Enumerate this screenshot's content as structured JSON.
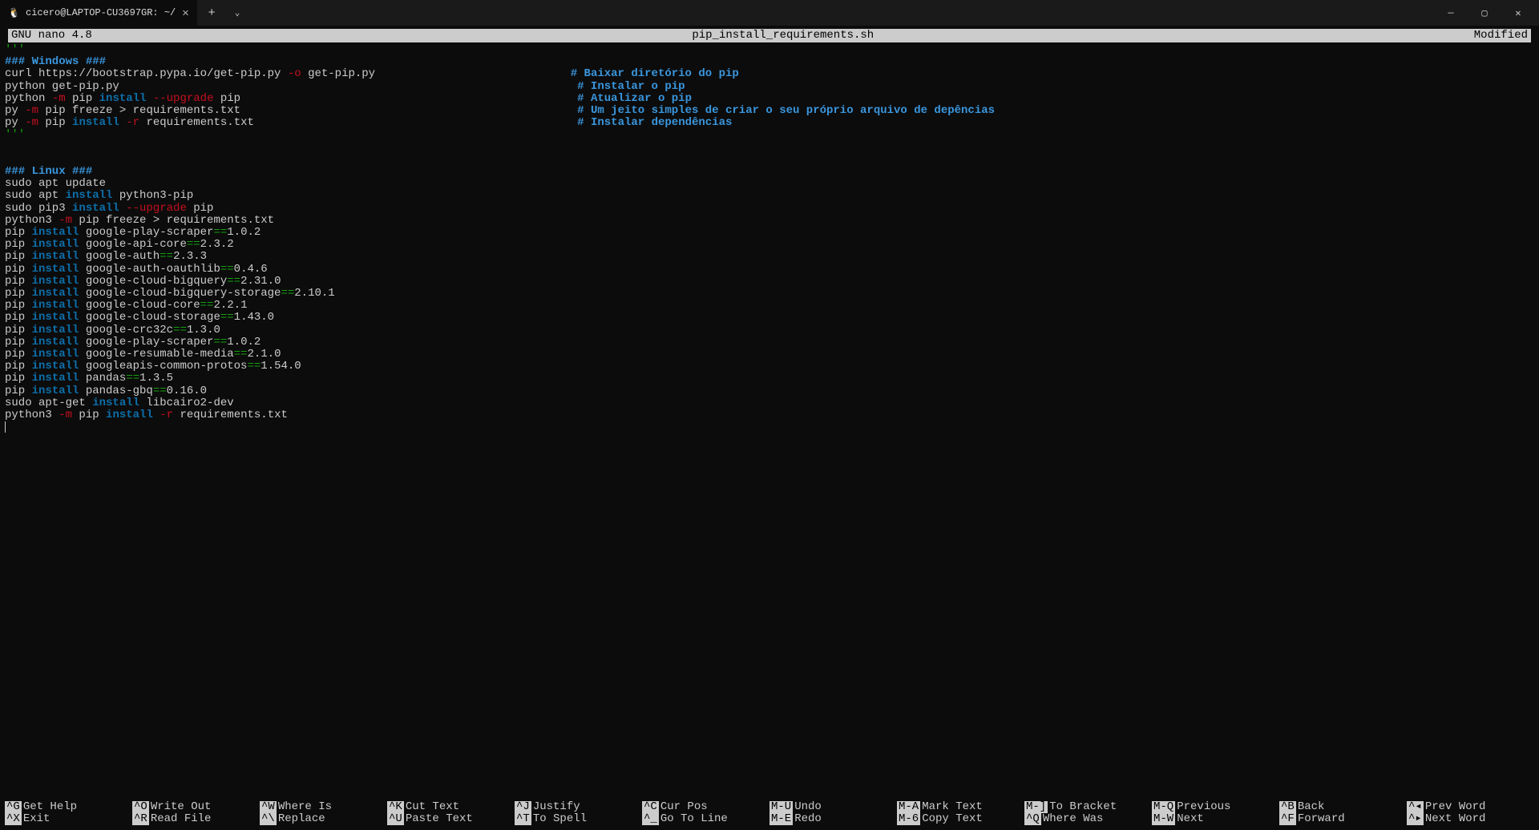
{
  "titlebar": {
    "tab_title": "cicero@LAPTOP-CU3697GR: ~/"
  },
  "nano": {
    "app": "GNU nano 4.8",
    "filename": "pip_install_requirements.sh",
    "status": "Modified"
  },
  "content": {
    "tq1": "'''",
    "win_header": "### Windows ###",
    "l_curl_a": "curl https://bootstrap.pypa.io/get-pip.py ",
    "l_curl_flag": "-o",
    "l_curl_b": " get-pip.py",
    "c1": "# Baixar diretório do pip",
    "l_getpip": "python get-pip.py",
    "c2": "# Instalar o pip",
    "l_upg_a": "python ",
    "l_upg_flag1": "-m",
    "l_upg_b": " pip ",
    "l_upg_install": "install",
    "l_upg_flag2": " --upgrade",
    "l_upg_c": " pip",
    "c3": "# Atualizar o pip",
    "l_freeze_a": "py ",
    "l_freeze_flag": "-m",
    "l_freeze_b": " pip freeze > requirements.txt",
    "c4": "# Um jeito simples de criar o seu próprio arquivo de depências",
    "l_req_a": "py ",
    "l_req_flag1": "-m",
    "l_req_b": " pip ",
    "l_req_install": "install",
    "l_req_flag2": " -r",
    "l_req_c": " requirements.txt",
    "c5": "# Instalar dependências",
    "tq2": "'''",
    "lin_header": "### Linux ###",
    "l_update": "sudo apt update",
    "l_aptinst_a": "sudo apt ",
    "l_aptinst_install": "install",
    "l_aptinst_b": " python3-pip",
    "l_pip3_a": "sudo pip3 ",
    "l_pip3_install": "install",
    "l_pip3_flag": " --upgrade",
    "l_pip3_b": " pip",
    "l_freeze3_a": "python3 ",
    "l_freeze3_f": "-m",
    "l_freeze3_b": " pip freeze > requirements.txt",
    "pkg": [
      {
        "pre": "pip ",
        "inst": "install",
        "mid": " google-play-scraper",
        "eq": "==",
        "ver": "1.0.2"
      },
      {
        "pre": "pip ",
        "inst": "install",
        "mid": " google-api-core",
        "eq": "==",
        "ver": "2.3.2"
      },
      {
        "pre": "pip ",
        "inst": "install",
        "mid": " google-auth",
        "eq": "==",
        "ver": "2.3.3"
      },
      {
        "pre": "pip ",
        "inst": "install",
        "mid": " google-auth-oauthlib",
        "eq": "==",
        "ver": "0.4.6"
      },
      {
        "pre": "pip ",
        "inst": "install",
        "mid": " google-cloud-bigquery",
        "eq": "==",
        "ver": "2.31.0"
      },
      {
        "pre": "pip ",
        "inst": "install",
        "mid": " google-cloud-bigquery-storage",
        "eq": "==",
        "ver": "2.10.1"
      },
      {
        "pre": "pip ",
        "inst": "install",
        "mid": " google-cloud-core",
        "eq": "==",
        "ver": "2.2.1"
      },
      {
        "pre": "pip ",
        "inst": "install",
        "mid": " google-cloud-storage",
        "eq": "==",
        "ver": "1.43.0"
      },
      {
        "pre": "pip ",
        "inst": "install",
        "mid": " google-crc32c",
        "eq": "==",
        "ver": "1.3.0"
      },
      {
        "pre": "pip ",
        "inst": "install",
        "mid": " google-play-scraper",
        "eq": "==",
        "ver": "1.0.2"
      },
      {
        "pre": "pip ",
        "inst": "install",
        "mid": " google-resumable-media",
        "eq": "==",
        "ver": "2.1.0"
      },
      {
        "pre": "pip ",
        "inst": "install",
        "mid": " googleapis-common-protos",
        "eq": "==",
        "ver": "1.54.0"
      },
      {
        "pre": "pip ",
        "inst": "install",
        "mid": " pandas",
        "eq": "==",
        "ver": "1.3.5"
      },
      {
        "pre": "pip ",
        "inst": "install",
        "mid": " pandas-gbq",
        "eq": "==",
        "ver": "0.16.0"
      }
    ],
    "l_libcairo_a": "sudo apt-get ",
    "l_libcairo_inst": "install",
    "l_libcairo_b": " libcairo2-dev",
    "l_preq_a": "python3 ",
    "l_preq_f1": "-m",
    "l_preq_b": " pip ",
    "l_preq_inst": "install",
    "l_preq_f2": " -r",
    "l_preq_c": " requirements.txt"
  },
  "shortcuts": [
    {
      "k": "^G",
      "l": "Get Help"
    },
    {
      "k": "^O",
      "l": "Write Out"
    },
    {
      "k": "^W",
      "l": "Where Is"
    },
    {
      "k": "^K",
      "l": "Cut Text"
    },
    {
      "k": "^J",
      "l": "Justify"
    },
    {
      "k": "^C",
      "l": "Cur Pos"
    },
    {
      "k": "M-U",
      "l": "Undo"
    },
    {
      "k": "M-A",
      "l": "Mark Text"
    },
    {
      "k": "M-]",
      "l": "To Bracket"
    },
    {
      "k": "M-Q",
      "l": "Previous"
    },
    {
      "k": "^B",
      "l": "Back"
    },
    {
      "k": "^◂",
      "l": "Prev Word"
    },
    {
      "k": "^X",
      "l": "Exit"
    },
    {
      "k": "^R",
      "l": "Read File"
    },
    {
      "k": "^\\",
      "l": "Replace"
    },
    {
      "k": "^U",
      "l": "Paste Text"
    },
    {
      "k": "^T",
      "l": "To Spell"
    },
    {
      "k": "^_",
      "l": "Go To Line"
    },
    {
      "k": "M-E",
      "l": "Redo"
    },
    {
      "k": "M-6",
      "l": "Copy Text"
    },
    {
      "k": "^Q",
      "l": "Where Was"
    },
    {
      "k": "M-W",
      "l": "Next"
    },
    {
      "k": "^F",
      "l": "Forward"
    },
    {
      "k": "^▸",
      "l": "Next Word"
    }
  ]
}
